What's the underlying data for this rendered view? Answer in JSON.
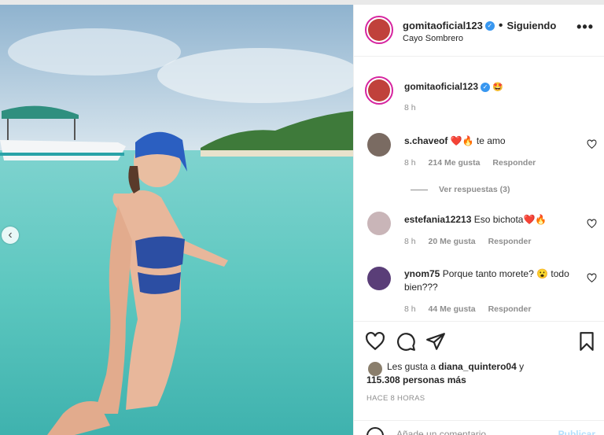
{
  "post": {
    "username": "gomitaoficial123",
    "follow_status": "Siguiendo",
    "location": "Cayo Sombrero",
    "separator": "•",
    "more_label": "•••"
  },
  "caption": {
    "username": "gomitaoficial123",
    "emoji": "🤩",
    "time": "8 h"
  },
  "comments": [
    {
      "username": "s.chaveof",
      "text": "❤️🔥 te amo",
      "time": "8 h",
      "likes": "214 Me gusta",
      "reply": "Responder",
      "view_replies": "Ver respuestas (3)"
    },
    {
      "username": "estefania12213",
      "text": "Eso bichota❤️🔥",
      "time": "8 h",
      "likes": "20 Me gusta",
      "reply": "Responder"
    },
    {
      "username": "ynom75",
      "text": "Porque tanto morete? 😮 todo bien???",
      "time": "8 h",
      "likes": "44 Me gusta",
      "reply": "Responder"
    }
  ],
  "likes": {
    "prefix": "Les gusta a",
    "user": "diana_quintero04",
    "conj": "y",
    "others": "115.308 personas más"
  },
  "time_ago": "HACE 8 HORAS",
  "add_comment": {
    "placeholder": "Añade un comentario...",
    "post_label": "Publicar"
  },
  "colors": {
    "verified": "#3897f0",
    "story_ring": "#d6249f",
    "water": "#5fc9c4"
  }
}
